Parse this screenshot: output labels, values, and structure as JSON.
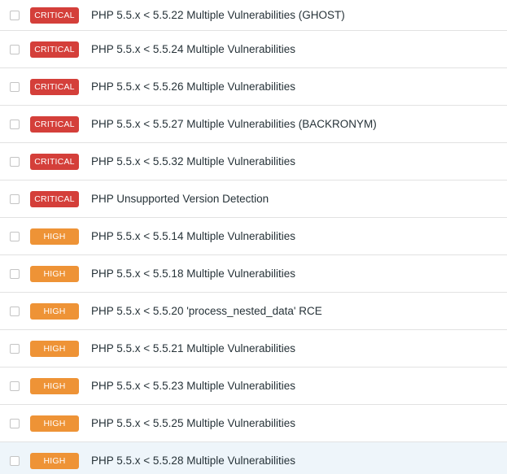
{
  "colors": {
    "critical": "#d43f3a",
    "high": "#ee9336",
    "hover_row": "#eef5fa",
    "divider": "#e2e2e2"
  },
  "vulnerabilities": [
    {
      "severity": "CRITICAL",
      "title": "PHP 5.5.x < 5.5.22 Multiple Vulnerabilities (GHOST)"
    },
    {
      "severity": "CRITICAL",
      "title": "PHP 5.5.x < 5.5.24 Multiple Vulnerabilities"
    },
    {
      "severity": "CRITICAL",
      "title": "PHP 5.5.x < 5.5.26 Multiple Vulnerabilities"
    },
    {
      "severity": "CRITICAL",
      "title": "PHP 5.5.x < 5.5.27 Multiple Vulnerabilities (BACKRONYM)"
    },
    {
      "severity": "CRITICAL",
      "title": "PHP 5.5.x < 5.5.32 Multiple Vulnerabilities"
    },
    {
      "severity": "CRITICAL",
      "title": "PHP Unsupported Version Detection"
    },
    {
      "severity": "HIGH",
      "title": "PHP 5.5.x < 5.5.14 Multiple Vulnerabilities"
    },
    {
      "severity": "HIGH",
      "title": "PHP 5.5.x < 5.5.18 Multiple Vulnerabilities"
    },
    {
      "severity": "HIGH",
      "title": "PHP 5.5.x < 5.5.20 'process_nested_data' RCE"
    },
    {
      "severity": "HIGH",
      "title": "PHP 5.5.x < 5.5.21 Multiple Vulnerabilities"
    },
    {
      "severity": "HIGH",
      "title": "PHP 5.5.x < 5.5.23 Multiple Vulnerabilities"
    },
    {
      "severity": "HIGH",
      "title": "PHP 5.5.x < 5.5.25 Multiple Vulnerabilities"
    },
    {
      "severity": "HIGH",
      "title": "PHP 5.5.x < 5.5.28 Multiple Vulnerabilities"
    }
  ]
}
